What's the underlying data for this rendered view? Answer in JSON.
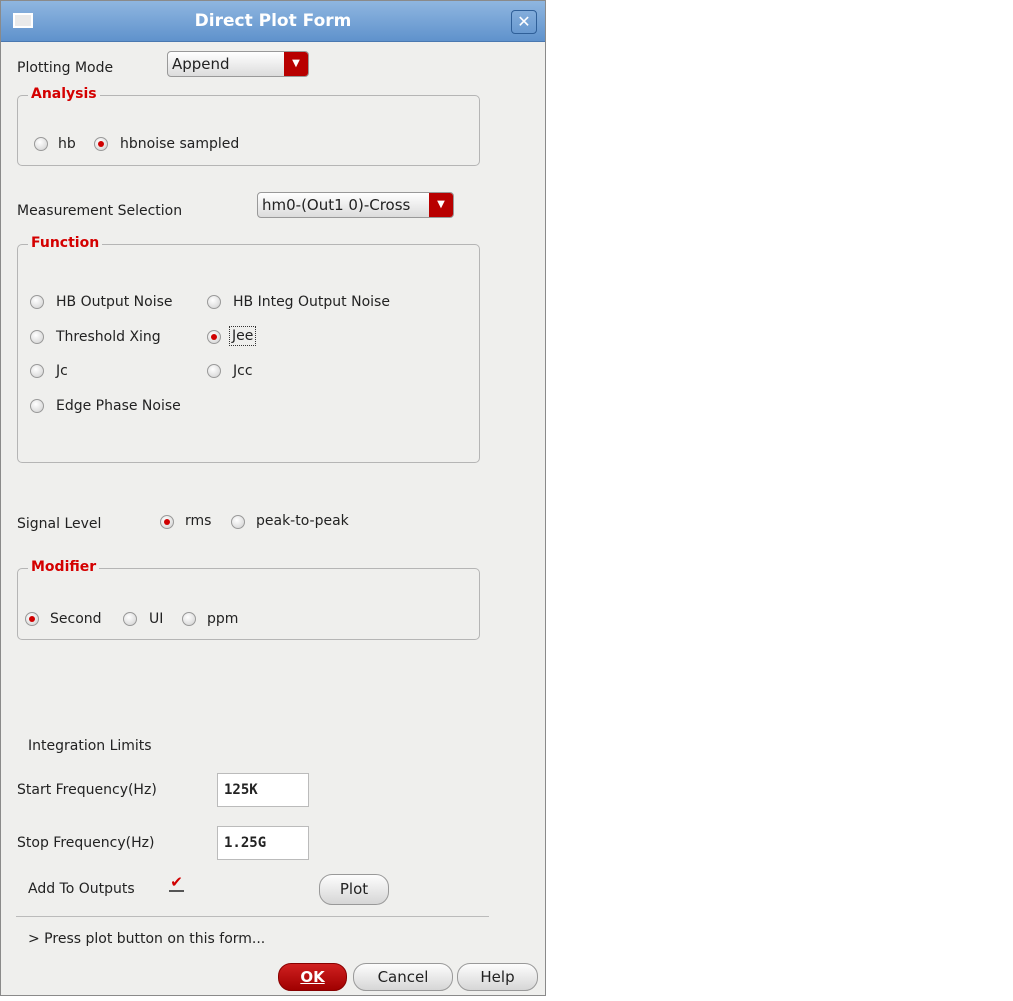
{
  "window": {
    "title": "Direct Plot Form"
  },
  "plotting_mode": {
    "label": "Plotting Mode",
    "value": "Append"
  },
  "analysis": {
    "legend": "Analysis",
    "options": [
      {
        "label": "hb",
        "selected": false
      },
      {
        "label": "hbnoise sampled",
        "selected": true
      }
    ]
  },
  "measurement": {
    "label": "Measurement Selection",
    "value": "hm0-(Out1 0)-Cross"
  },
  "function": {
    "legend": "Function",
    "options": [
      {
        "label": "HB Output Noise",
        "selected": false
      },
      {
        "label": "HB Integ Output Noise",
        "selected": false
      },
      {
        "label": "Threshold Xing",
        "selected": false
      },
      {
        "label": "Jee",
        "selected": true
      },
      {
        "label": "Jc",
        "selected": false
      },
      {
        "label": "Jcc",
        "selected": false
      },
      {
        "label": "Edge Phase Noise",
        "selected": false
      }
    ]
  },
  "signal_level": {
    "label": "Signal Level",
    "options": [
      {
        "label": "rms",
        "selected": true
      },
      {
        "label": "peak-to-peak",
        "selected": false
      }
    ]
  },
  "modifier": {
    "legend": "Modifier",
    "options": [
      {
        "label": "Second",
        "selected": true
      },
      {
        "label": "UI",
        "selected": false
      },
      {
        "label": "ppm",
        "selected": false
      }
    ]
  },
  "integration": {
    "label": "Integration Limits",
    "start_label": "Start Frequency(Hz)",
    "start_value": "125K",
    "stop_label": "Stop Frequency(Hz)",
    "stop_value": "1.25G"
  },
  "add_to_outputs": {
    "label": "Add To Outputs",
    "checked": true
  },
  "plot_button": "Plot",
  "status": "> Press plot button on this form...",
  "buttons": {
    "ok": "OK",
    "cancel": "Cancel",
    "help": "Help"
  }
}
